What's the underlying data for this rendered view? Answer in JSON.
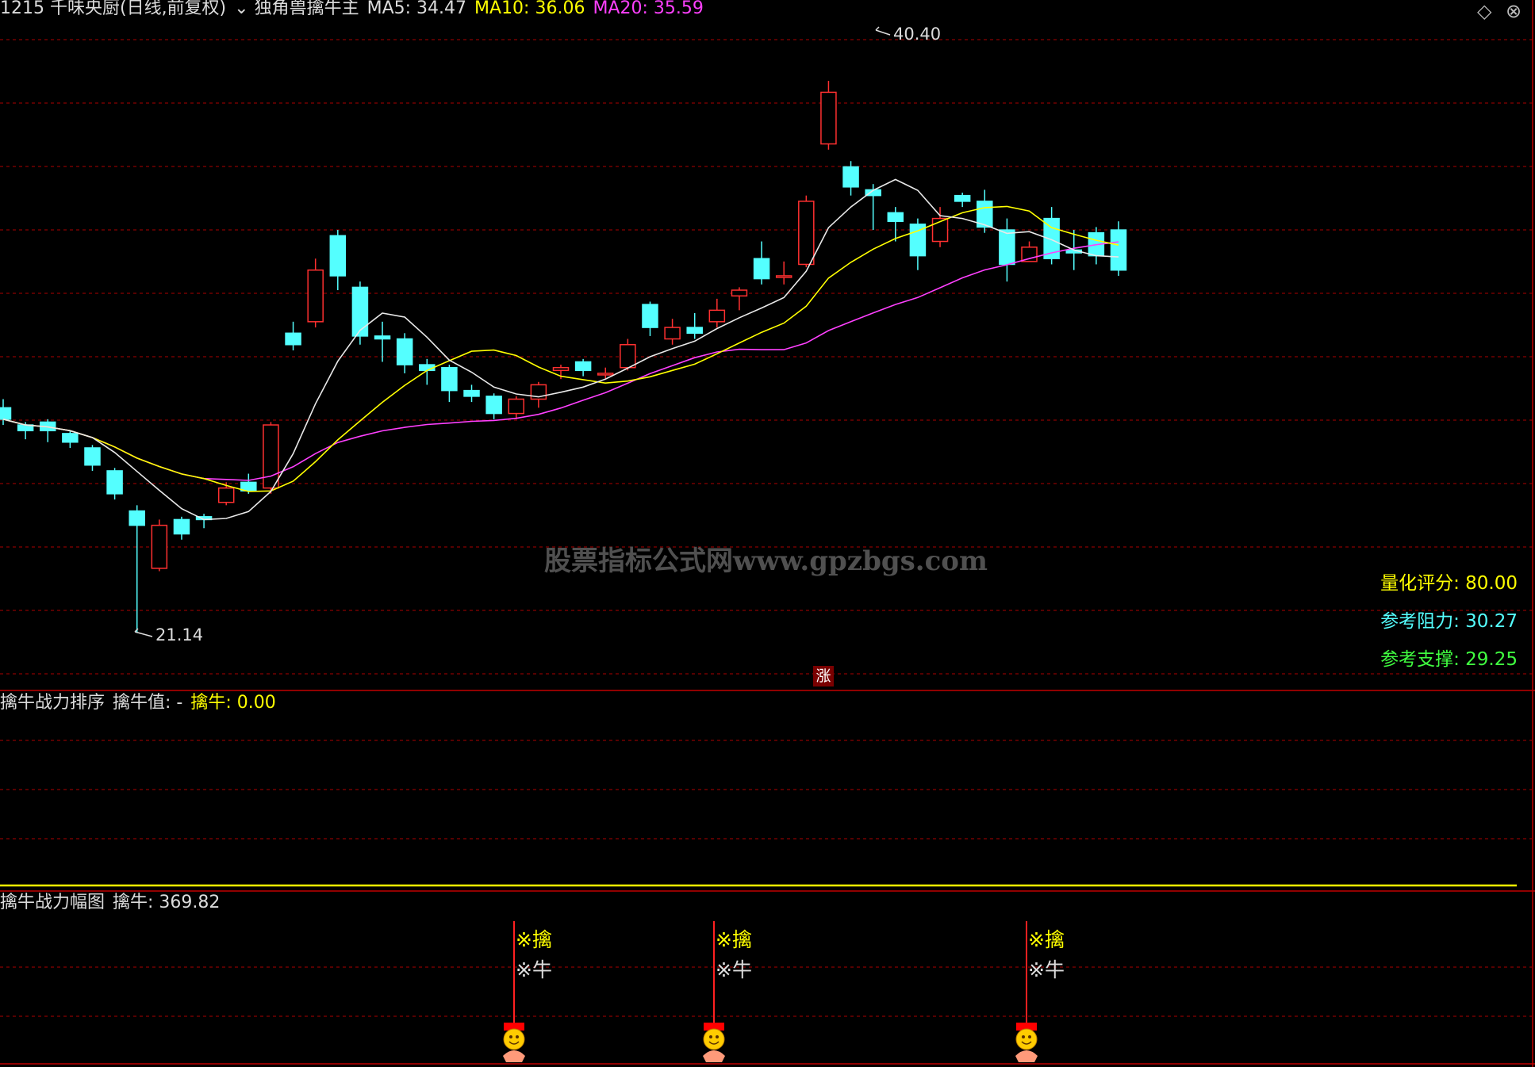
{
  "header": {
    "code_name": "1215 千味央厨(日线,前复权)",
    "indicator": "独角兽擒牛主",
    "ma5": "MA5: 34.47",
    "ma10": "MA10: 36.06",
    "ma20": "MA20: 35.59"
  },
  "info": {
    "score": "量化评分: 80.00",
    "resistance": "参考阻力: 30.27",
    "support": "参考支撑: 29.25"
  },
  "extremes": {
    "high": "40.40",
    "low": "21.14"
  },
  "watermark": "股票指标公式网www.gpzbgs.com",
  "zhang_badge": "涨",
  "panel2": {
    "title": "擒牛战力排序",
    "value_label": "擒牛值: -",
    "value": "擒牛: 0.00"
  },
  "panel3": {
    "title": "擒牛战力幅图",
    "value": "擒牛: 369.82"
  },
  "signal": {
    "line1": "※擒",
    "line2": "※牛"
  },
  "window_controls": {
    "diamond": "◇",
    "close": "⊗"
  },
  "colors": {
    "up": "#ff3030",
    "down": "#54ffff",
    "ma5": "#e8e8e8",
    "ma10": "#ffff00",
    "ma20": "#ff40ff",
    "grid": "#8a0000"
  },
  "chart_data": {
    "type": "candlestick",
    "price_range": [
      19.5,
      42.5
    ],
    "candles": [
      [
        29.0,
        28.6,
        29.3,
        28.4
      ],
      [
        28.4,
        28.2,
        28.5,
        27.9
      ],
      [
        28.5,
        28.2,
        28.6,
        27.8
      ],
      [
        28.1,
        27.8,
        28.2,
        27.6
      ],
      [
        27.6,
        27.0,
        27.7,
        26.8
      ],
      [
        26.8,
        26.0,
        26.9,
        25.8
      ],
      [
        25.4,
        24.9,
        25.6,
        21.14
      ],
      [
        23.4,
        24.9,
        25.1,
        23.3
      ],
      [
        25.1,
        24.6,
        25.2,
        24.4
      ],
      [
        25.2,
        25.1,
        25.3,
        24.8
      ],
      [
        25.7,
        26.2,
        26.4,
        25.6
      ],
      [
        26.4,
        26.1,
        26.7,
        26.0
      ],
      [
        26.2,
        28.4,
        28.5,
        26.0
      ],
      [
        31.6,
        31.2,
        32.0,
        31.0
      ],
      [
        32.0,
        33.8,
        34.2,
        31.8
      ],
      [
        35.0,
        33.6,
        35.2,
        33.1
      ],
      [
        33.2,
        31.5,
        33.4,
        31.2
      ],
      [
        31.5,
        31.4,
        32.0,
        30.6
      ],
      [
        31.4,
        30.5,
        31.6,
        30.2
      ],
      [
        30.5,
        30.3,
        30.7,
        29.8
      ],
      [
        30.4,
        29.6,
        30.5,
        29.2
      ],
      [
        29.6,
        29.4,
        29.8,
        29.2
      ],
      [
        29.4,
        28.8,
        29.5,
        28.6
      ],
      [
        28.8,
        29.3,
        29.4,
        28.6
      ],
      [
        29.3,
        29.8,
        29.9,
        29.0
      ],
      [
        30.3,
        30.4,
        30.5,
        30.0
      ],
      [
        30.6,
        30.3,
        30.7,
        30.1
      ],
      [
        30.2,
        30.2,
        30.4,
        30.0
      ],
      [
        30.4,
        31.2,
        31.4,
        30.3
      ],
      [
        32.6,
        31.8,
        32.7,
        31.5
      ],
      [
        31.4,
        31.8,
        32.1,
        31.2
      ],
      [
        31.8,
        31.6,
        32.3,
        31.4
      ],
      [
        32.0,
        32.4,
        32.8,
        31.8
      ],
      [
        32.9,
        33.1,
        33.2,
        32.4
      ],
      [
        34.2,
        33.5,
        34.8,
        33.3
      ],
      [
        33.6,
        33.6,
        34.1,
        33.3
      ],
      [
        34.0,
        36.2,
        36.4,
        33.9
      ],
      [
        38.2,
        40.0,
        40.4,
        38.0
      ],
      [
        37.4,
        36.7,
        37.6,
        36.4
      ],
      [
        36.6,
        36.4,
        36.8,
        35.2
      ],
      [
        35.8,
        35.5,
        36.0,
        34.8
      ],
      [
        35.4,
        34.3,
        35.6,
        33.8
      ],
      [
        34.8,
        35.6,
        36.0,
        34.6
      ],
      [
        36.4,
        36.2,
        36.5,
        36.0
      ],
      [
        36.2,
        35.3,
        36.6,
        35.1
      ],
      [
        35.2,
        34.0,
        35.6,
        33.4
      ],
      [
        34.1,
        34.6,
        34.8,
        34.2
      ],
      [
        35.6,
        34.2,
        36.0,
        34.0
      ],
      [
        34.5,
        34.4,
        35.2,
        33.8
      ],
      [
        35.1,
        34.3,
        35.3,
        34.0
      ],
      [
        35.2,
        33.8,
        35.5,
        33.6
      ]
    ],
    "ma5_label": "MA5: 34.47",
    "ma10_label": "MA10: 36.06",
    "ma20_label": "MA20: 35.59"
  }
}
